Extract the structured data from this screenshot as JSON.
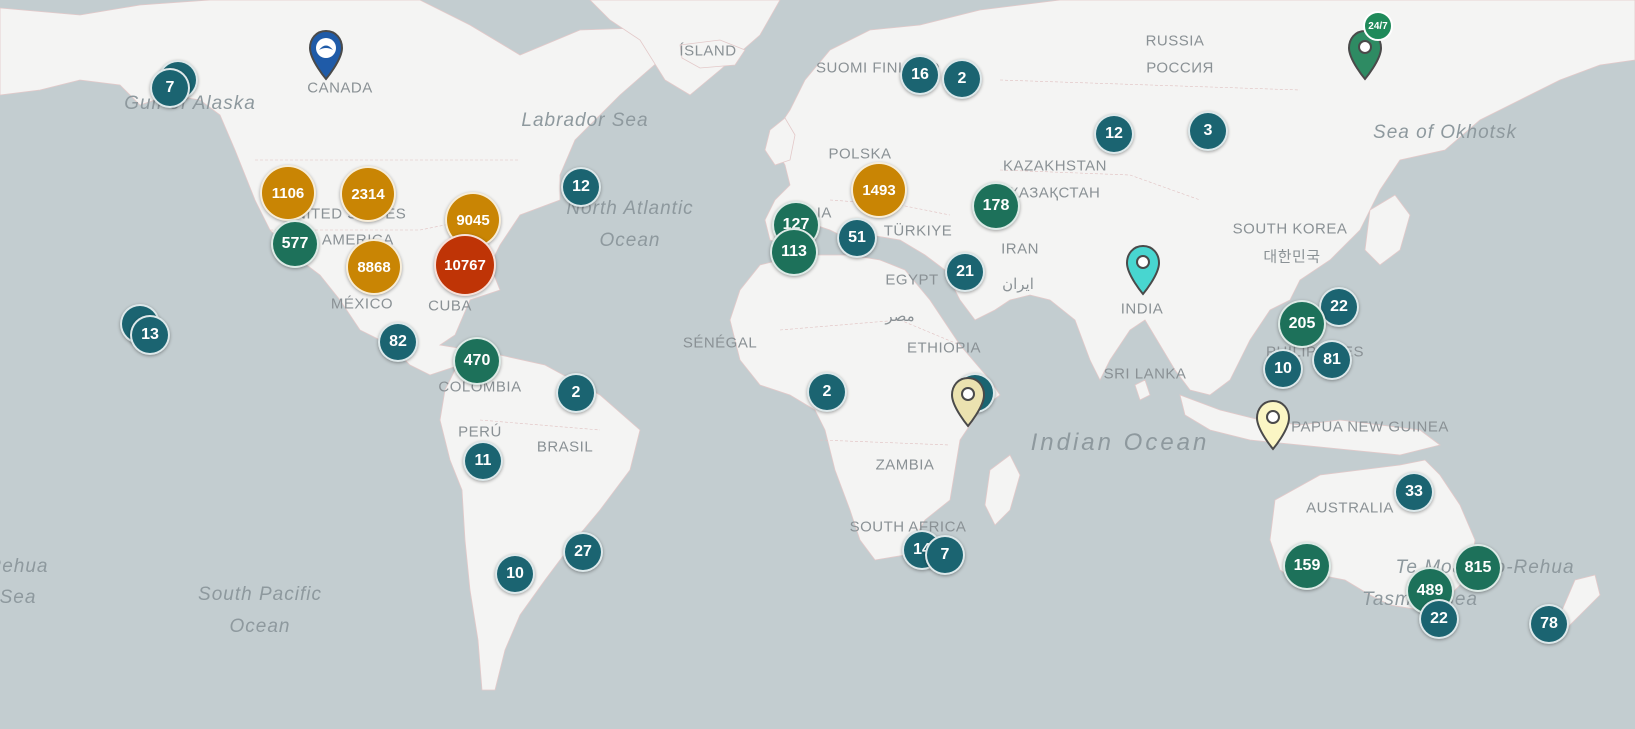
{
  "colors": {
    "water": "#c3cdd0",
    "land": "#f4f4f3",
    "teal_cluster": "#1b6471",
    "green_cluster": "#1d715a",
    "orange_cluster": "#c98504",
    "red_cluster": "#bf3406"
  },
  "country_labels": [
    {
      "text": "CANADA",
      "name": "canada"
    },
    {
      "text": "UNITED STATES",
      "name": "united-states"
    },
    {
      "text": "OF AMERICA",
      "name": "of-america"
    },
    {
      "text": "MÉXICO",
      "name": "mexico"
    },
    {
      "text": "CUBA",
      "name": "cuba"
    },
    {
      "text": "COLOMBIA",
      "name": "colombia"
    },
    {
      "text": "PERÚ",
      "name": "peru"
    },
    {
      "text": "BRASIL",
      "name": "brasil"
    },
    {
      "text": "ÍSLAND",
      "name": "island"
    },
    {
      "text": "SUOMI FINLAND",
      "name": "finland"
    },
    {
      "text": "POLSKA",
      "name": "polska"
    },
    {
      "text": "ITALIA",
      "name": "italia"
    },
    {
      "text": "TÜRKIYE",
      "name": "turkiye"
    },
    {
      "text": "EGYPT",
      "name": "egypt"
    },
    {
      "text": "مصر",
      "name": "egypt-arabic"
    },
    {
      "text": "SÉNÉGAL",
      "name": "senegal"
    },
    {
      "text": "ETHIOPIA",
      "name": "ethiopia"
    },
    {
      "text": "ZAMBIA",
      "name": "zambia"
    },
    {
      "text": "SOUTH AFRICA",
      "name": "south-africa"
    },
    {
      "text": "RUSSIA",
      "name": "russia"
    },
    {
      "text": "РОССИЯ",
      "name": "russia-cyrillic"
    },
    {
      "text": "KAZAKHSTAN",
      "name": "kazakhstan"
    },
    {
      "text": "ҚАЗАҚСТАН",
      "name": "kazakhstan-cyrillic"
    },
    {
      "text": "IRAN",
      "name": "iran"
    },
    {
      "text": "ایران",
      "name": "iran-persian"
    },
    {
      "text": "INDIA",
      "name": "india"
    },
    {
      "text": "SRI LANKA",
      "name": "sri-lanka"
    },
    {
      "text": "SOUTH KOREA",
      "name": "south-korea"
    },
    {
      "text": "대한민국",
      "name": "south-korea-hangul"
    },
    {
      "text": "PHILIPPINES",
      "name": "philippines"
    },
    {
      "text": "PAPUA NEW GUINEA",
      "name": "papua-new-guinea"
    },
    {
      "text": "AUSTRALIA",
      "name": "australia"
    }
  ],
  "ocean_labels": [
    {
      "text": "Gulf of Alaska",
      "name": "gulf-of-alaska"
    },
    {
      "text": "Labrador Sea",
      "name": "labrador-sea"
    },
    {
      "text": "North Atlantic",
      "name": "north-atlantic"
    },
    {
      "text": "Ocean",
      "name": "north-atlantic-ocean"
    },
    {
      "text": "South Pacific",
      "name": "south-pacific"
    },
    {
      "text": "Ocean",
      "name": "south-pacific-ocean"
    },
    {
      "text": "Sea of Okhotsk",
      "name": "sea-of-okhotsk"
    },
    {
      "text": "Indian Ocean",
      "name": "indian-ocean"
    },
    {
      "text": "Tasman Sea",
      "name": "tasman-sea"
    },
    {
      "text": "Te Moana-o-Rehua",
      "name": "te-moana-o-rehua"
    },
    {
      "text": "Rehua",
      "name": "rehua-left"
    },
    {
      "text": "Sea",
      "name": "sea-left"
    }
  ],
  "clusters": [
    {
      "count": "",
      "color": "teal"
    },
    {
      "count": "7",
      "color": "teal"
    },
    {
      "count": "16",
      "color": "teal"
    },
    {
      "count": "2",
      "color": "teal"
    },
    {
      "count": "12",
      "color": "teal"
    },
    {
      "count": "3",
      "color": "teal"
    },
    {
      "count": "1106",
      "color": "orange"
    },
    {
      "count": "2314",
      "color": "orange"
    },
    {
      "count": "9045",
      "color": "orange"
    },
    {
      "count": "12",
      "color": "teal"
    },
    {
      "count": "577",
      "color": "green"
    },
    {
      "count": "8868",
      "color": "orange"
    },
    {
      "count": "10767",
      "color": "red"
    },
    {
      "count": "1493",
      "color": "orange"
    },
    {
      "count": "178",
      "color": "green"
    },
    {
      "count": "127",
      "color": "green"
    },
    {
      "count": "113",
      "color": "green"
    },
    {
      "count": "51",
      "color": "teal"
    },
    {
      "count": "21",
      "color": "teal"
    },
    {
      "count": "",
      "color": "teal"
    },
    {
      "count": "13",
      "color": "teal"
    },
    {
      "count": "82",
      "color": "teal"
    },
    {
      "count": "470",
      "color": "green"
    },
    {
      "count": "2",
      "color": "teal"
    },
    {
      "count": "2",
      "color": "teal"
    },
    {
      "count": "2",
      "color": "teal"
    },
    {
      "count": "22",
      "color": "teal"
    },
    {
      "count": "205",
      "color": "green"
    },
    {
      "count": "10",
      "color": "teal"
    },
    {
      "count": "81",
      "color": "teal"
    },
    {
      "count": "11",
      "color": "teal"
    },
    {
      "count": "33",
      "color": "teal"
    },
    {
      "count": "27",
      "color": "teal"
    },
    {
      "count": "14",
      "color": "teal"
    },
    {
      "count": "7",
      "color": "teal"
    },
    {
      "count": "10",
      "color": "teal"
    },
    {
      "count": "159",
      "color": "green"
    },
    {
      "count": "815",
      "color": "green"
    },
    {
      "count": "489",
      "color": "green"
    },
    {
      "count": "22",
      "color": "teal"
    },
    {
      "count": "78",
      "color": "teal"
    }
  ],
  "markers": [
    {
      "name": "canada-logo-pin",
      "icon": "logo-pin-icon",
      "color": "#1f5ba8"
    },
    {
      "name": "russia-247-pin",
      "icon": "map-pin-icon",
      "color": "#2e8b63",
      "badge": "24/7"
    },
    {
      "name": "india-pin",
      "icon": "map-pin-icon",
      "color": "#48d6d0"
    },
    {
      "name": "indonesia-pin",
      "icon": "map-pin-icon",
      "color": "#fbf6c4"
    },
    {
      "name": "ethiopia-pin",
      "icon": "map-pin-icon",
      "color": "#ebe2b0"
    }
  ]
}
